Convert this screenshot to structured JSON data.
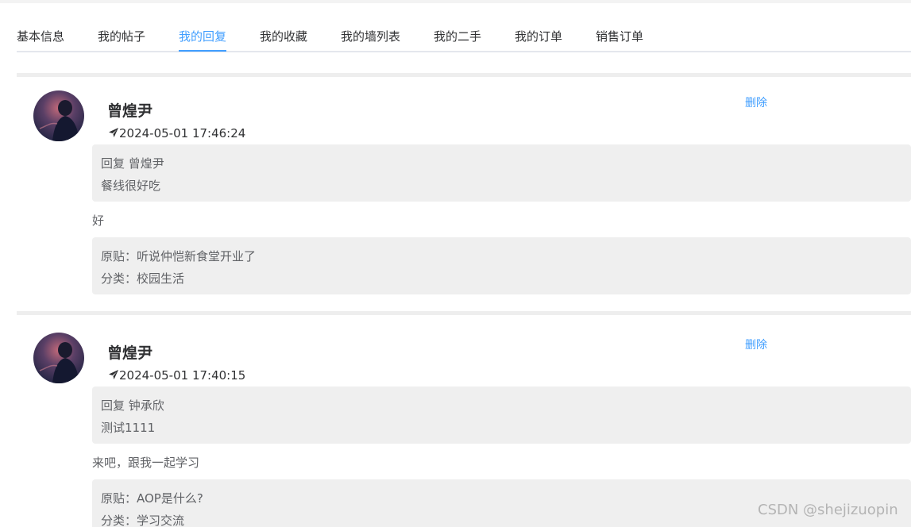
{
  "tabs": [
    {
      "label": "基本信息",
      "active": false
    },
    {
      "label": "我的帖子",
      "active": false
    },
    {
      "label": "我的回复",
      "active": true
    },
    {
      "label": "我的收藏",
      "active": false
    },
    {
      "label": "我的墙列表",
      "active": false
    },
    {
      "label": "我的二手",
      "active": false
    },
    {
      "label": "我的订单",
      "active": false
    },
    {
      "label": "销售订单",
      "active": false
    }
  ],
  "replies": [
    {
      "username": "曾煌尹",
      "time": "2024-05-01 17:46:24",
      "delete_label": "删除",
      "reply_to": "回复 曾煌尹",
      "quoted_content": "餐线很好吃",
      "content": "好",
      "original_post": "原贴：听说仲恺新食堂开业了",
      "category": "分类：校园生活"
    },
    {
      "username": "曾煌尹",
      "time": "2024-05-01 17:40:15",
      "delete_label": "删除",
      "reply_to": "回复 钟承欣",
      "quoted_content": "测试1111",
      "content": "来吧，跟我一起学习",
      "original_post": "原贴：AOP是什么?",
      "category": "分类：学习交流"
    }
  ],
  "icons": {
    "send": "send-icon",
    "avatar": "avatar-image"
  },
  "colors": {
    "accent": "#409eff",
    "quote_bg": "#efefef",
    "text": "#303133",
    "muted": "#606266"
  },
  "watermark": "CSDN @shejizuopin"
}
